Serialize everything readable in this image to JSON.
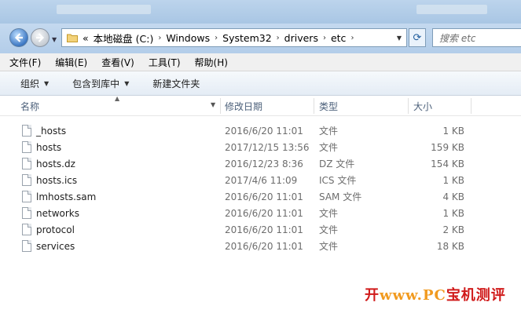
{
  "navigation": {
    "breadcrumb": [
      "本地磁盘 (C:)",
      "Windows",
      "System32",
      "drivers",
      "etc"
    ],
    "overflow_marker": "«",
    "search_placeholder": "搜索 etc"
  },
  "menu": [
    "文件(F)",
    "编辑(E)",
    "查看(V)",
    "工具(T)",
    "帮助(H)"
  ],
  "toolbar": {
    "organize": "组织",
    "include_library": "包含到库中",
    "new_folder": "新建文件夹"
  },
  "columns": {
    "name": "名称",
    "date": "修改日期",
    "type": "类型",
    "size": "大小"
  },
  "files": [
    {
      "name": "_hosts",
      "date": "2016/6/20 11:01",
      "type": "文件",
      "size": "1 KB"
    },
    {
      "name": "hosts",
      "date": "2017/12/15 13:56",
      "type": "文件",
      "size": "159 KB"
    },
    {
      "name": "hosts.dz",
      "date": "2016/12/23 8:36",
      "type": "DZ 文件",
      "size": "154 KB"
    },
    {
      "name": "hosts.ics",
      "date": "2017/4/6 11:09",
      "type": "ICS 文件",
      "size": "1 KB"
    },
    {
      "name": "lmhosts.sam",
      "date": "2016/6/20 11:01",
      "type": "SAM 文件",
      "size": "4 KB"
    },
    {
      "name": "networks",
      "date": "2016/6/20 11:01",
      "type": "文件",
      "size": "1 KB"
    },
    {
      "name": "protocol",
      "date": "2016/6/20 11:01",
      "type": "文件",
      "size": "2 KB"
    },
    {
      "name": "services",
      "date": "2016/6/20 11:01",
      "type": "文件",
      "size": "18 KB"
    }
  ],
  "watermark": {
    "left": "开",
    "middle": "www.PC",
    "right": "宝机测评"
  },
  "icons": {
    "back": "arrow-left-icon",
    "forward": "arrow-right-icon",
    "folder": "folder-icon",
    "refresh": "refresh-icon",
    "file": "file-icon"
  }
}
